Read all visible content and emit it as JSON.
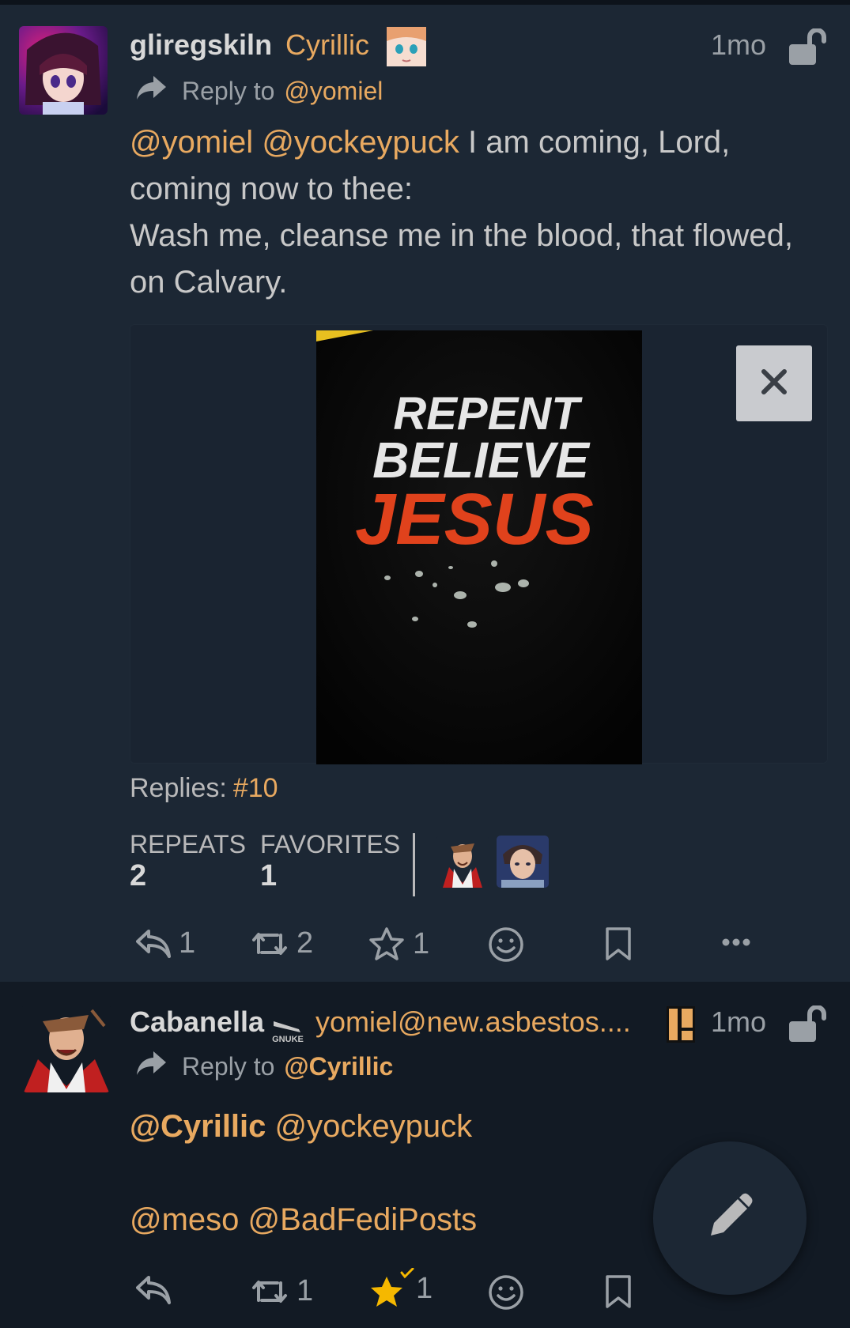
{
  "post1": {
    "username": "gliregskiln",
    "handle": "Cyrillic",
    "time": "1mo",
    "reply_label": "Reply to",
    "reply_to": "@yomiel",
    "content": {
      "mention1": "@yomiel",
      "mention2": "@yockeypuck",
      "text1": " I am coming, Lord,",
      "line2": "coming now to thee:",
      "line3": "Wash me, cleanse me in the blood, that flowed,",
      "line4": "on Calvary."
    },
    "image_text": {
      "line1": "REPENT",
      "line2": "BELIEVE",
      "line3": "JESUS"
    },
    "replies_label": "Replies:",
    "replies_value": "#10",
    "repeats_label": "REPEATS",
    "repeats_value": "2",
    "favorites_label": "FAVORITES",
    "favorites_value": "1",
    "actions": {
      "reply_count": "1",
      "repeat_count": "2",
      "favorite_count": "1"
    }
  },
  "post2": {
    "username": "Cabanella",
    "badge_text": "GNUKE",
    "handle": "yomiel@new.asbestos....",
    "time": "1mo",
    "reply_label": "Reply to",
    "reply_to": "@Cyrillic",
    "content": {
      "mention1": "@Cyrillic",
      "mention2": "@yockeypuck",
      "mention3": "@meso",
      "mention4": "@BadFediPosts"
    },
    "actions": {
      "repeat_count": "1",
      "favorite_count": "1"
    }
  },
  "colors": {
    "accent": "#e8a960",
    "post_bg": "#1c2734",
    "page_bg": "#121a24",
    "text": "#b9b9ba",
    "favorite_star": "#f5b800"
  },
  "icons": [
    "reply-icon",
    "repeat-icon",
    "star-icon",
    "emoji-icon",
    "bookmark-icon",
    "more-icon",
    "unlock-icon",
    "close-icon",
    "pencil-icon"
  ]
}
